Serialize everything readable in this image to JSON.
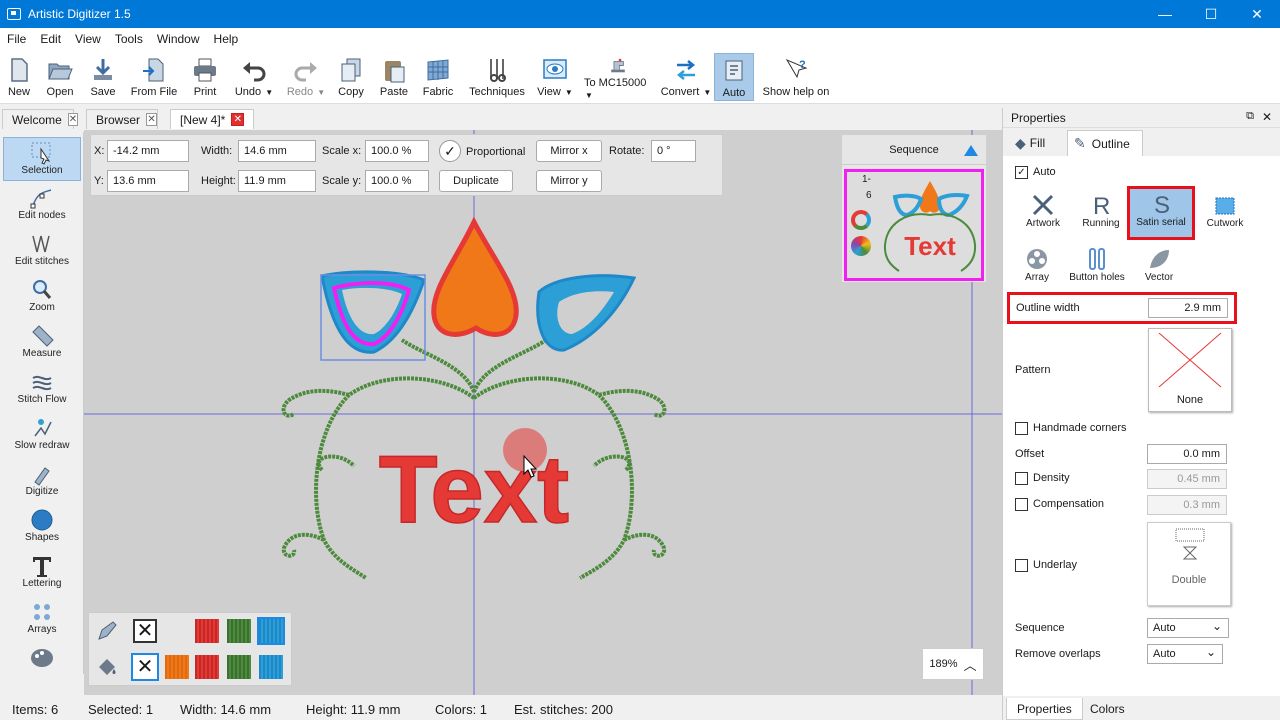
{
  "window": {
    "title": "Artistic Digitizer 1.5",
    "min": "—",
    "max": "☐",
    "close": "✕"
  },
  "menu": [
    "File",
    "Edit",
    "View",
    "Tools",
    "Window",
    "Help"
  ],
  "toolbar": [
    "New",
    "Open",
    "Save",
    "From File",
    "Print",
    "Undo",
    "Redo",
    "Copy",
    "Paste",
    "Fabric",
    "Techniques",
    "View",
    "To MC15000",
    "Convert",
    "Auto",
    "Show help on"
  ],
  "tabs": [
    "Welcome",
    "Browser",
    "[New 4]*"
  ],
  "tools": [
    "Selection",
    "Edit nodes",
    "Edit stitches",
    "Zoom",
    "Measure",
    "Stitch Flow",
    "Slow redraw",
    "Digitize",
    "Shapes",
    "Lettering",
    "Arrays"
  ],
  "props": {
    "x_label": "X:",
    "x_value": "-14.2 mm",
    "y_label": "Y:",
    "y_value": "13.6 mm",
    "width_label": "Width:",
    "width_value": "14.6 mm",
    "height_label": "Height:",
    "height_value": "11.9 mm",
    "scalex_label": "Scale x:",
    "scalex_value": "100.0 %",
    "scaley_label": "Scale y:",
    "scaley_value": "100.0 %",
    "proportional": "Proportional",
    "duplicate": "Duplicate",
    "mirror_x": "Mirror x",
    "mirror_y": "Mirror y",
    "rotate_label": "Rotate:",
    "rotate_value": "0 °"
  },
  "sequence": {
    "title": "Sequence",
    "count_top": "1-",
    "count_bottom": "6",
    "thumb_text": "Text"
  },
  "design_text": "Text",
  "zoom": "189%",
  "status": {
    "items": "Items: 6",
    "selected": "Selected: 1",
    "width": "Width: 14.6 mm",
    "height": "Height: 11.9 mm",
    "colors": "Colors: 1",
    "stitches": "Est. stitches: 200"
  },
  "panel": {
    "title": "Properties",
    "tab_fill": "Fill",
    "tab_outline": "Outline",
    "auto": "Auto",
    "outline_types": [
      "Artwork",
      "Running",
      "Satin serial",
      "Cutwork",
      "Array",
      "Button holes",
      "Vector"
    ],
    "outline_width_label": "Outline width",
    "outline_width_value": "2.9 mm",
    "pattern_label": "Pattern",
    "pattern_value": "None",
    "handmade": "Handmade corners",
    "offset_label": "Offset",
    "offset_value": "0.0 mm",
    "density_label": "Density",
    "density_value": "0.45 mm",
    "compensation_label": "Compensation",
    "compensation_value": "0.3 mm",
    "underlay_label": "Underlay",
    "underlay_value": "Double",
    "sequence_label": "Sequence",
    "sequence_value": "Auto",
    "remove_label": "Remove overlaps",
    "remove_value": "Auto",
    "bottom_tab_properties": "Properties",
    "bottom_tab_colors": "Colors"
  },
  "colors": {
    "accent": "#0078d7",
    "red": "#e53935",
    "orange": "#f07818",
    "blue": "#2b9fd6",
    "green": "#4c8a3c",
    "magenta": "#f21ff2"
  }
}
